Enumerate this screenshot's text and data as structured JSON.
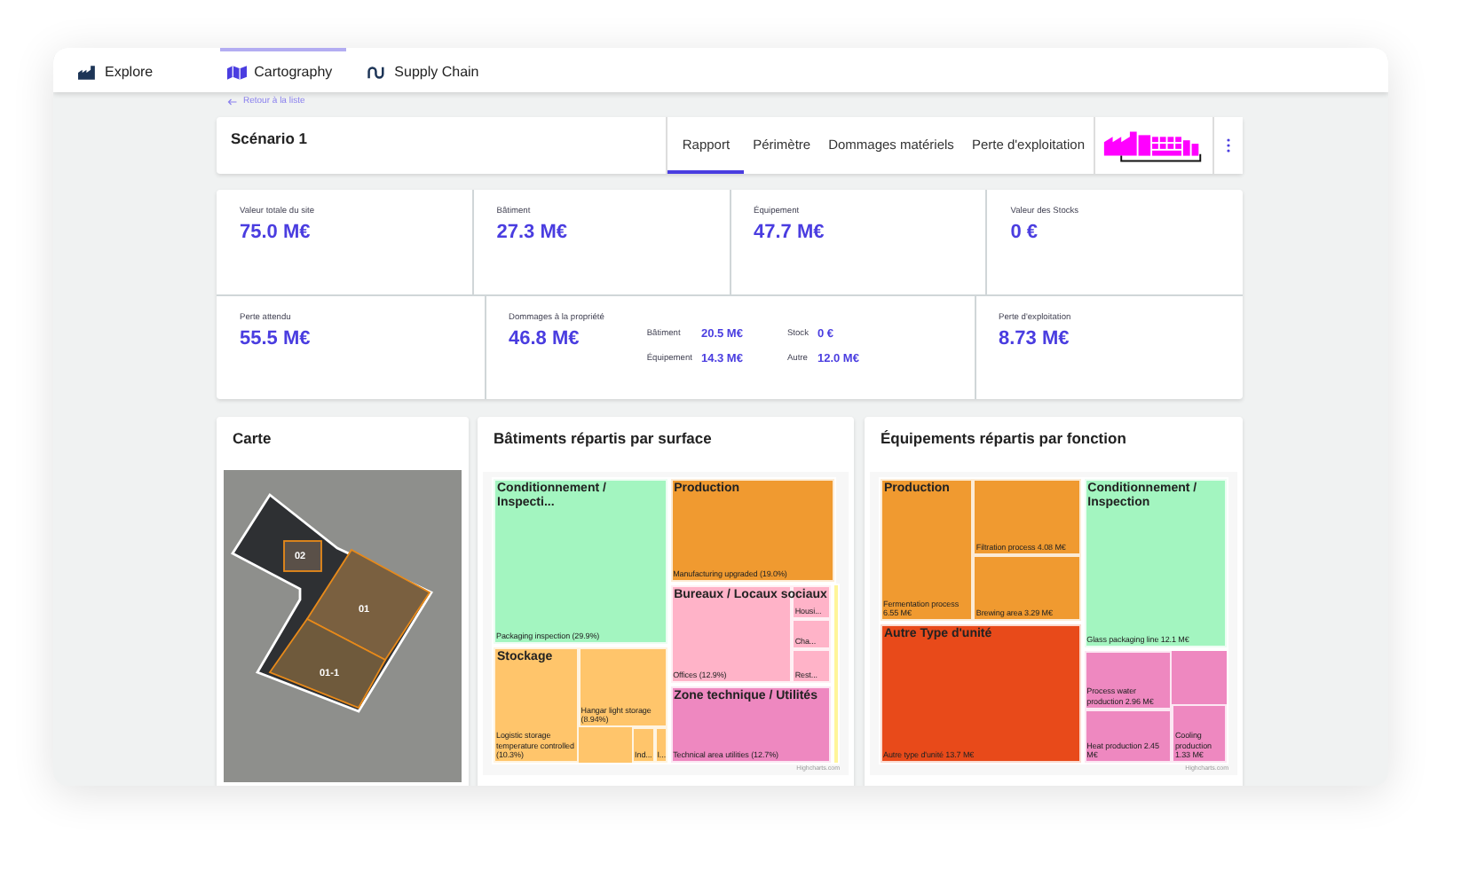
{
  "nav": [
    {
      "label": "Explore",
      "selected": false
    },
    {
      "label": "Cartography",
      "selected": true
    },
    {
      "label": "Supply Chain",
      "selected": false
    }
  ],
  "back_link": "Retour à la liste",
  "scenario": {
    "title": "Scénario 1",
    "tabs": [
      {
        "label": "Rapport",
        "selected": true
      },
      {
        "label": "Périmètre",
        "selected": false
      },
      {
        "label": "Dommages matériels",
        "selected": false
      },
      {
        "label": "Perte d'exploitation",
        "selected": false
      }
    ]
  },
  "kpis_row1": [
    {
      "label": "Valeur totale du site",
      "value": "75.0 M€"
    },
    {
      "label": "Bâtiment",
      "value": "27.3 M€"
    },
    {
      "label": "Équipement",
      "value": "47.7 M€"
    },
    {
      "label": "Valeur des Stocks",
      "value": "0 €"
    }
  ],
  "kpis_row2": [
    {
      "label": "Perte attendu",
      "value": "55.5 M€"
    },
    {
      "label": "Dommages à la propriété",
      "value": "46.8 M€",
      "breakdown": [
        {
          "label": "Bâtiment",
          "value": "20.5 M€"
        },
        {
          "label": "Stock",
          "value": "0 €"
        },
        {
          "label": "Équipement",
          "value": "14.3 M€"
        },
        {
          "label": "Autre",
          "value": "12.0 M€"
        }
      ]
    },
    {
      "label": "Perte d'exploitation",
      "value": "8.73 M€"
    }
  ],
  "map_card": {
    "title": "Carte",
    "parcels": [
      {
        "label": "02"
      },
      {
        "label": "01"
      },
      {
        "label": "01-1"
      }
    ]
  },
  "treemaps": [
    {
      "title": "Bâtiments répartis par surface",
      "credit": "Highcharts.com",
      "groups": [
        {
          "title": "Conditionnement / Inspecti...",
          "color": "#a3f5c0",
          "leaves": [
            {
              "label": "Packaging inspection (29.9%)"
            }
          ]
        },
        {
          "title": "Production",
          "color": "#f09a30",
          "leaves": [
            {
              "label": "Manufacturing upgraded (19.0%)"
            }
          ]
        },
        {
          "title": "Bureaux / Locaux sociaux",
          "color": "#ffb3c8",
          "leaves": [
            {
              "label": "Offices (12.9%)"
            },
            {
              "label": "Housi..."
            },
            {
              "label": "Cha..."
            },
            {
              "label": "Rest..."
            }
          ]
        },
        {
          "title": "Stockage",
          "color": "#ffc56b",
          "leaves": [
            {
              "label": "Logistic storage temperature controlled (10.3%)"
            },
            {
              "label": "Hangar light storage (8.94%)"
            },
            {
              "label": "Ind..."
            },
            {
              "label": "I..."
            }
          ]
        },
        {
          "title": "Zone technique / Utilités",
          "color": "#ee88c0",
          "leaves": [
            {
              "label": "Technical area utilities (12.7%)"
            }
          ]
        },
        {
          "color": "#fff59a"
        }
      ]
    },
    {
      "title": "Équipements répartis par fonction",
      "credit": "Highcharts.com",
      "groups": [
        {
          "title": "Production",
          "color": "#f09a30",
          "leaves": [
            {
              "label": "Fermentation process 6.55 M€"
            },
            {
              "label": "Filtration process 4.08 M€"
            },
            {
              "label": "Brewing area 3.29 M€"
            }
          ]
        },
        {
          "title": "Conditionnement / Inspection",
          "color": "#a3f5c0",
          "leaves": [
            {
              "label": "Glass packaging line 12.1 M€"
            }
          ]
        },
        {
          "title": "Autre Type d'unité",
          "color": "#e84a1a",
          "leaves": [
            {
              "label": "Autre type d'unité 13.7 M€"
            }
          ]
        },
        {
          "color": "#ee88c0",
          "leaves": [
            {
              "label": "Process water production 2.96 M€"
            },
            {
              "label": "Heat production 2.45 M€"
            },
            {
              "label": "Cooling production 1.33 M€"
            }
          ]
        }
      ]
    }
  ]
}
